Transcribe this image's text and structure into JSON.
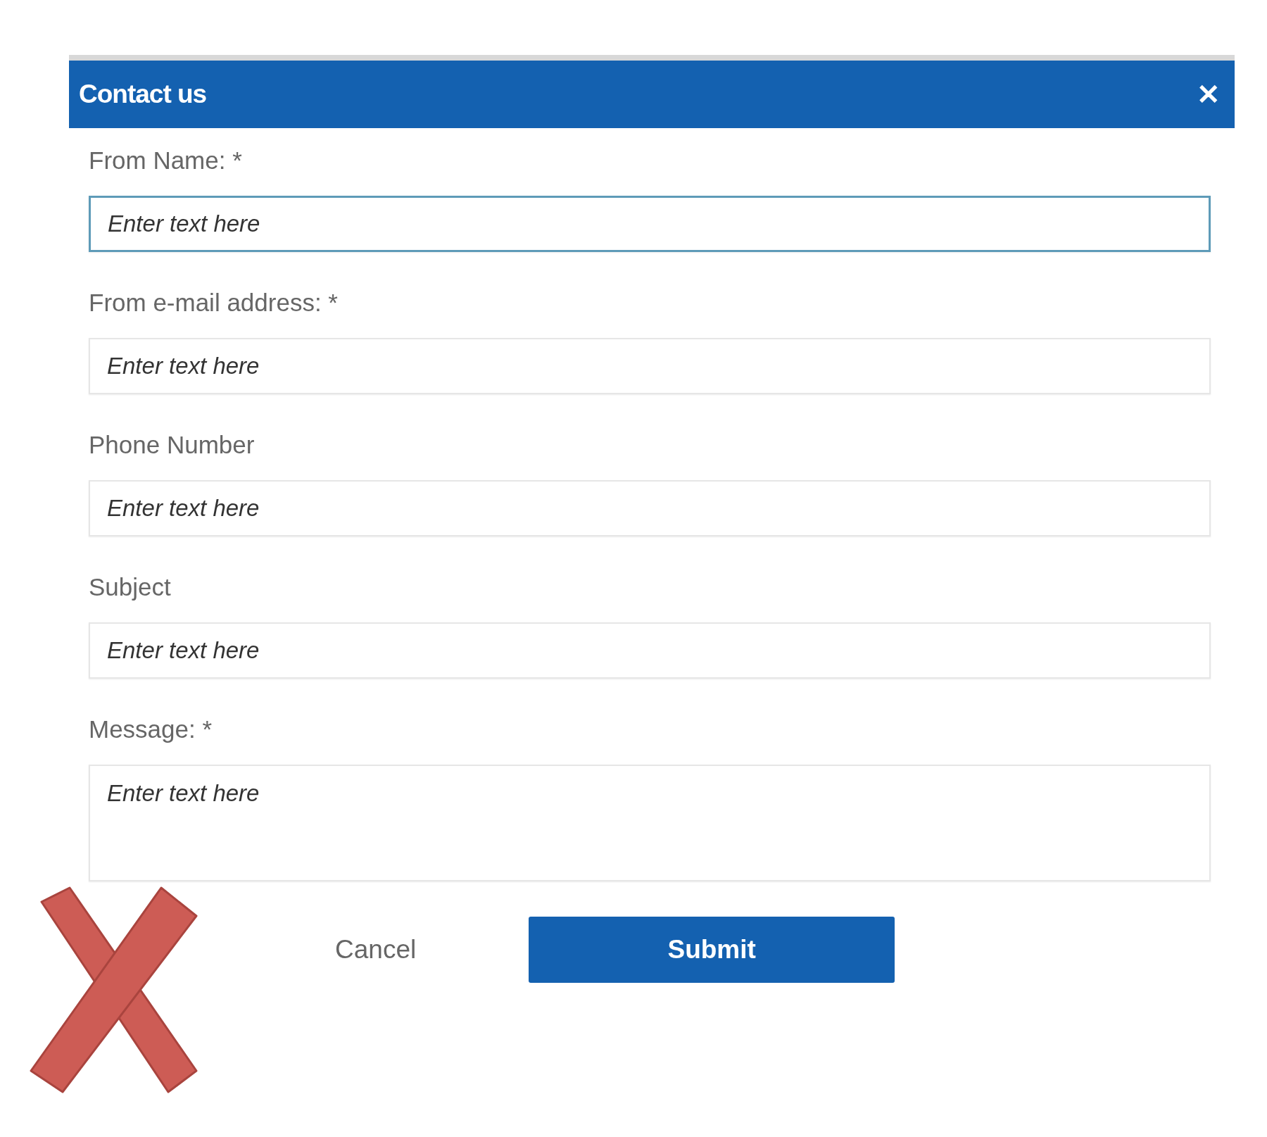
{
  "dialog": {
    "title": "Contact us",
    "close": "✕"
  },
  "fields": [
    {
      "label": "From Name: *",
      "placeholder": "Enter text here",
      "kind": "text",
      "focused": true
    },
    {
      "label": "From e-mail address: *",
      "placeholder": "Enter text here",
      "kind": "text",
      "focused": false
    },
    {
      "label": "Phone Number",
      "placeholder": "Enter text here",
      "kind": "text",
      "focused": false
    },
    {
      "label": "Subject",
      "placeholder": "Enter text here",
      "kind": "text",
      "focused": false
    },
    {
      "label": "Message: *",
      "placeholder": "Enter text here",
      "kind": "textarea",
      "focused": false
    }
  ],
  "buttons": {
    "cancel": "Cancel",
    "submit": "Submit"
  }
}
